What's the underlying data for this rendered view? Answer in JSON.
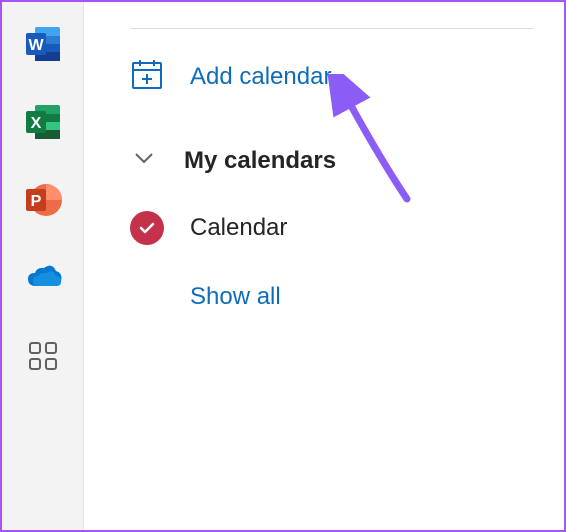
{
  "appRail": {
    "items": [
      {
        "name": "word",
        "letter": "W",
        "color1": "#2b579a",
        "color2": "#41a5ee"
      },
      {
        "name": "excel",
        "letter": "X",
        "color1": "#107c41",
        "color2": "#21a366"
      },
      {
        "name": "powerpoint",
        "letter": "P",
        "color1": "#c43e1c",
        "color2": "#ed6c47"
      },
      {
        "name": "onedrive",
        "type": "cloud"
      },
      {
        "name": "apps",
        "type": "grid"
      }
    ]
  },
  "sidebar": {
    "add_calendar_label": "Add calendar",
    "section_title": "My calendars",
    "calendar_item": "Calendar",
    "show_all_label": "Show all"
  }
}
